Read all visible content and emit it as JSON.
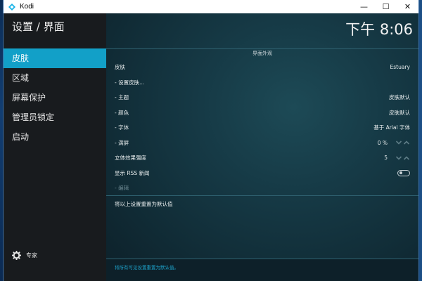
{
  "window": {
    "title": "Kodi",
    "controls": {
      "minimize": "—",
      "maximize": "☐",
      "close": "✕"
    }
  },
  "sidebar": {
    "title": "设置 / 界面",
    "items": [
      {
        "label": "皮肤",
        "active": true
      },
      {
        "label": "区域",
        "active": false
      },
      {
        "label": "屏幕保护",
        "active": false
      },
      {
        "label": "管理员锁定",
        "active": false
      },
      {
        "label": "启动",
        "active": false
      }
    ],
    "level_label": "专家",
    "level_icon": "gear-icon"
  },
  "header": {
    "clock": "下午 8:06"
  },
  "content": {
    "section_header": "界面外观",
    "rows": [
      {
        "label": "皮肤",
        "value": "Estuary"
      },
      {
        "label": "- 设置皮肤...",
        "value": ""
      },
      {
        "label": "- 主题",
        "value": "皮肤默认"
      },
      {
        "label": "- 颜色",
        "value": "皮肤默认"
      },
      {
        "label": "- 字体",
        "value": "基于 Arial 字体"
      },
      {
        "label": "- 满屏",
        "value": "0 %"
      },
      {
        "label": "立体效果强度",
        "value": "5"
      },
      {
        "label": "显示 RSS 新闻",
        "value": ""
      },
      {
        "label": "- 编辑",
        "value": ""
      }
    ],
    "reset_label": "将以上设置重置为默认值",
    "footer_hint": "将所有可见设置重置为默认值。"
  },
  "colors": {
    "accent": "#12a0c8",
    "sidebar_bg": "#181b1e",
    "panel_bg": "#163a46",
    "hint_text": "#1ea6cf"
  }
}
